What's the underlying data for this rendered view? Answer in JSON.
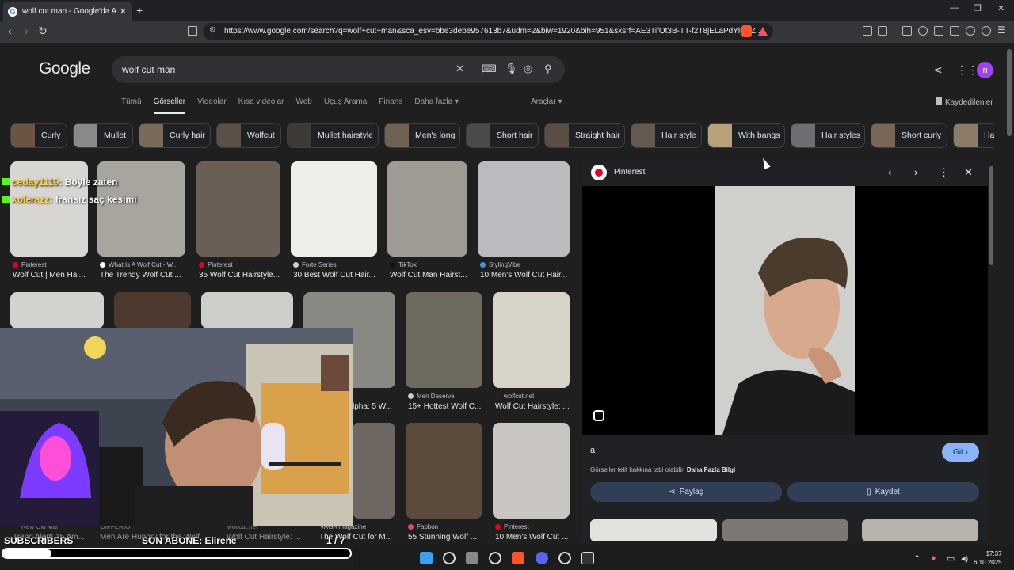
{
  "browser": {
    "tab_title": "wolf cut man - Google'da Ara",
    "tab_close": "✕",
    "new_tab": "+",
    "url": "https://www.google.com/search?q=wolf+cut+man&sca_esv=bbe3debe957613b7&udm=2&biw=1920&bih=951&sxsrf=AE3TifOt3B-TT-f2T8jELaPdYlumZ...",
    "window_controls": [
      "—",
      "❐",
      "✕"
    ]
  },
  "google": {
    "logo": "Google",
    "query": "wolf cut man",
    "tabs": [
      "Tümü",
      "Görseller",
      "Videolar",
      "Kısa videolar",
      "Web",
      "Uçuş Arama",
      "Finans",
      "Daha fazla ▾"
    ],
    "active_tab": "Görseller",
    "tools": "Araçlar ▾",
    "saved": "Kaydedilenler",
    "avatar_letter": "n"
  },
  "chips": [
    {
      "label": "Curly",
      "color": "#6b5443"
    },
    {
      "label": "Mullet",
      "color": "#8a8a8a"
    },
    {
      "label": "Curly hair",
      "color": "#7a6a5c"
    },
    {
      "label": "Wolfcut",
      "color": "#5a5048"
    },
    {
      "label": "Mullet hairstyle",
      "color": "#3e3a36"
    },
    {
      "label": "Men's long",
      "color": "#716155"
    },
    {
      "label": "Short hair",
      "color": "#4b4a4d"
    },
    {
      "label": "Straight hair",
      "color": "#5b4e44"
    },
    {
      "label": "Hair style",
      "color": "#655a52"
    },
    {
      "label": "With bangs",
      "color": "#b8a27a"
    },
    {
      "label": "Hair styles",
      "color": "#6d6f73"
    },
    {
      "label": "Short curly",
      "color": "#7a6656"
    },
    {
      "label": "Ha",
      "color": "#8e7c6b"
    }
  ],
  "grid": {
    "row1": [
      {
        "source": "Pinterest",
        "caption": "Wolf Cut | Men Hai...",
        "color": "#d8d6d2",
        "fav": "#e60023"
      },
      {
        "source": "What Is A Wolf Cut - W...",
        "caption": "The Trendy Wolf Cut ...",
        "color": "#a8a49e",
        "fav": "#ffffff"
      },
      {
        "source": "Pinterest",
        "caption": "35 Wolf Cut Hairstyle...",
        "color": "#6a5f55",
        "fav": "#e60023"
      },
      {
        "source": "Forte Series",
        "caption": "30 Best Wolf Cut Hair...",
        "color": "#efeee9",
        "fav": "#cccccc"
      },
      {
        "source": "TikTok",
        "caption": "Wolf Cut Man Hairst...",
        "color": "#9f9a94",
        "fav": "#111111"
      },
      {
        "source": "StylingVibe",
        "caption": "10 Men's Wolf Cut Hair...",
        "color": "#b9bbbf",
        "fav": "#4a90d9"
      }
    ],
    "row2": [
      {
        "source": "Men Deserve",
        "caption": "15+ Hottest Wolf C...",
        "color": "#6f6a5e",
        "fav": "#cccccc"
      },
      {
        "source": "wolfcut.net",
        "caption": "Wolf Cut Hairstyle: ...",
        "color": "#d9d4c8",
        "fav": "#222222"
      }
    ],
    "row2_partial": "lpha: 5 W...",
    "row3": [
      {
        "source": "Fabbon",
        "caption": "55 Stunning Wolf ...",
        "color": "#5b4b3d",
        "fav": "#e8457a"
      },
      {
        "source": "Pinterest",
        "caption": "10 Men's Wolf Cut ...",
        "color": "#c9c6c2",
        "fav": "#e60023"
      }
    ],
    "row3_obscured": [
      {
        "source": "New Old Man",
        "caption": "Trend Alert! 15 Am..."
      },
      {
        "source": "DIFFERIO",
        "caption": "Men Are Hungry for the Wolf ..."
      },
      {
        "source": "wolfcut.net",
        "caption": "Wolf Cut Hairstyle: ..."
      },
      {
        "source": "VAGA magazine",
        "caption": "The Wolf Cut for M..."
      }
    ]
  },
  "panel": {
    "source": "Pinterest",
    "text": "a",
    "go_button": "Git ›",
    "copyright": "Görseller telif hakkına tabi olabilir.",
    "more_info": "Daha Fazla Bilgi",
    "share": "Paylaş",
    "save": "Kaydet"
  },
  "stream": {
    "chat": [
      {
        "user": "ceday1119",
        "message": ": Böyle zaten"
      },
      {
        "user": "xolerazz",
        "message": ": fransız saç kesimi"
      }
    ],
    "subscribers_label": "SUBSCRIBERS",
    "last_sub": "SON ABONE: Eiirene",
    "counter": "1 / 7",
    "progress": 0.14
  },
  "taskbar": {
    "time": "17:37",
    "date": "6.10.2025"
  }
}
